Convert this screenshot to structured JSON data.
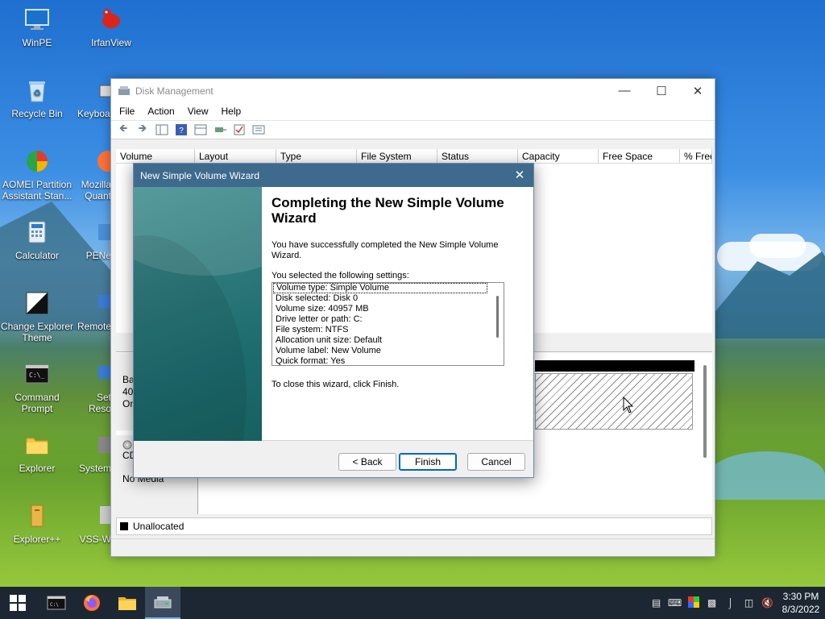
{
  "desktop": {
    "icons": [
      {
        "label": "WinPE"
      },
      {
        "label": "IrfanView"
      },
      {
        "label": "Recycle Bin"
      },
      {
        "label": "Keyboa"
      },
      {
        "label": "AOMEI Partition Assistant Stan..."
      },
      {
        "label": "Mozilla Quant"
      },
      {
        "label": "Calculator"
      },
      {
        "label": "PENe"
      },
      {
        "label": "Change Explorer Theme"
      },
      {
        "label": "Remote"
      },
      {
        "label": "Command Prompt"
      },
      {
        "label": "Set Reso"
      },
      {
        "label": "Explorer"
      },
      {
        "label": "System"
      },
      {
        "label": "Explorer++"
      },
      {
        "label": "VSS-W"
      }
    ]
  },
  "disk_management": {
    "title": "Disk Management",
    "menu": [
      "File",
      "Action",
      "View",
      "Help"
    ],
    "columns": [
      "Volume",
      "Layout",
      "Type",
      "File System",
      "Status",
      "Capacity",
      "Free Space",
      "% Free"
    ],
    "disk0_lines": [
      "Bas",
      "40.",
      "On"
    ],
    "cd_lines": [
      "CD",
      "No Media"
    ],
    "legend_unallocated": "Unallocated"
  },
  "wizard": {
    "title": "New Simple Volume Wizard",
    "heading": "Completing the New Simple Volume Wizard",
    "success_text": "You have successfully completed the New Simple Volume Wizard.",
    "settings_intro": "You selected the following settings:",
    "settings": [
      "Volume type: Simple Volume",
      "Disk selected: Disk 0",
      "Volume size: 40957 MB",
      "Drive letter or path: C:",
      "File system: NTFS",
      "Allocation unit size: Default",
      "Volume label: New Volume",
      "Quick format: Yes"
    ],
    "close_text": "To close this wizard, click Finish.",
    "back_label": "< Back",
    "finish_label": "Finish",
    "cancel_label": "Cancel"
  },
  "taskbar": {
    "time": "3:30 PM",
    "date": "8/3/2022"
  },
  "colors": {
    "wizard_titlebar": "#3e6a8e",
    "wizard_sidebar": "#2f7a7c",
    "taskbar": "#1c2733",
    "accent": "#0067c0"
  }
}
